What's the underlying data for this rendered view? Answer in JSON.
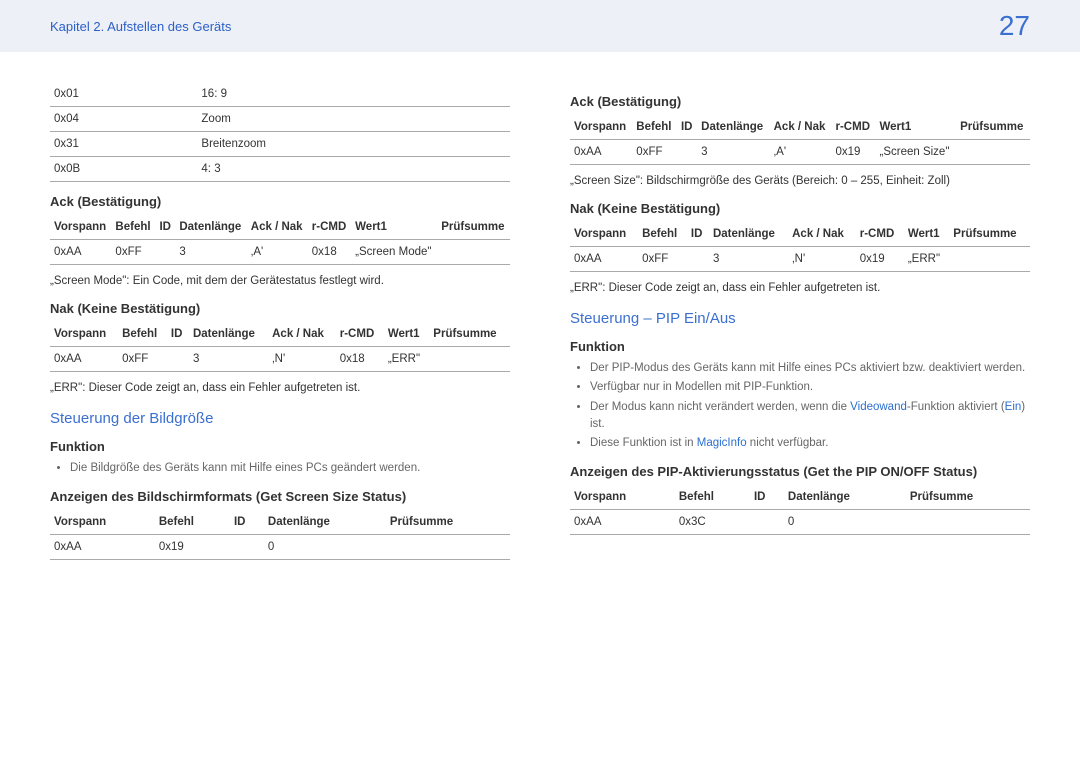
{
  "header": {
    "chapter": "Kapitel 2. Aufstellen des Geräts",
    "page": "27"
  },
  "left": {
    "codes": [
      [
        "0x01",
        "16: 9"
      ],
      [
        "0x04",
        "Zoom"
      ],
      [
        "0x31",
        "Breitenzoom"
      ],
      [
        "0x0B",
        "4: 3"
      ]
    ],
    "ack_title": "Ack (Bestätigung)",
    "ack_head": [
      "Vorspann",
      "Befehl",
      "ID",
      "Datenlänge",
      "Ack / Nak",
      "r-CMD",
      "Wert1",
      "Prüfsumme"
    ],
    "ack_row": [
      "0xAA",
      "0xFF",
      "",
      "3",
      "‚A'",
      "0x18",
      "„Screen Mode\"",
      ""
    ],
    "ack_note": "„Screen Mode\": Ein Code, mit dem der Gerätestatus festlegt wird.",
    "nak_title": "Nak (Keine Bestätigung)",
    "nak_row": [
      "0xAA",
      "0xFF",
      "",
      "3",
      "‚N'",
      "0x18",
      "„ERR\"",
      ""
    ],
    "nak_note": "„ERR\": Dieser Code zeigt an, dass ein Fehler aufgetreten ist.",
    "sec_title": "Steuerung der Bildgröße",
    "func_title": "Funktion",
    "func_bullet": "Die Bildgröße des Geräts kann mit Hilfe eines PCs geändert werden.",
    "status_title": "Anzeigen des Bildschirmformats (Get Screen Size Status)",
    "status_head": [
      "Vorspann",
      "Befehl",
      "ID",
      "Datenlänge",
      "Prüfsumme"
    ],
    "status_row": [
      "0xAA",
      "0x19",
      "",
      "0",
      ""
    ]
  },
  "right": {
    "ack_title": "Ack (Bestätigung)",
    "ack_head": [
      "Vorspann",
      "Befehl",
      "ID",
      "Datenlänge",
      "Ack / Nak",
      "r-CMD",
      "Wert1",
      "Prüfsumme"
    ],
    "ack_row": [
      "0xAA",
      "0xFF",
      "",
      "3",
      "‚A'",
      "0x19",
      "„Screen Size\"",
      ""
    ],
    "ack_note": "„Screen Size\": Bildschirmgröße des Geräts (Bereich: 0 – 255, Einheit: Zoll)",
    "nak_title": "Nak (Keine Bestätigung)",
    "nak_row": [
      "0xAA",
      "0xFF",
      "",
      "3",
      "‚N'",
      "0x19",
      "„ERR\"",
      ""
    ],
    "nak_note": "„ERR\": Dieser Code zeigt an, dass ein Fehler aufgetreten ist.",
    "sec_title": "Steuerung – PIP Ein/Aus",
    "func_title": "Funktion",
    "bullets": [
      "Der PIP-Modus des Geräts kann mit Hilfe eines PCs aktiviert bzw. deaktiviert werden.",
      "Verfügbar nur in Modellen mit PIP-Funktion."
    ],
    "bullet_videowand_pre": "Der Modus kann nicht verändert werden, wenn die ",
    "bullet_videowand_link": "Videowand",
    "bullet_videowand_post": "-Funktion aktiviert (",
    "bullet_ein": "Ein",
    "bullet_close": ") ist.",
    "bullet_magic_pre": "Diese Funktion ist in ",
    "bullet_magic_link": "MagicInfo",
    "bullet_magic_post": " nicht verfügbar.",
    "status_title": "Anzeigen des PIP-Aktivierungsstatus (Get the PIP ON/OFF Status)",
    "status_head": [
      "Vorspann",
      "Befehl",
      "ID",
      "Datenlänge",
      "Prüfsumme"
    ],
    "status_row": [
      "0xAA",
      "0x3C",
      "",
      "0",
      ""
    ]
  }
}
